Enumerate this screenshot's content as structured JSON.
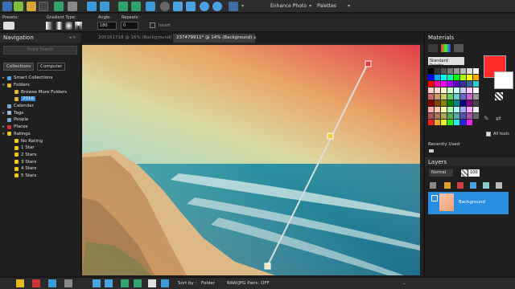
{
  "toolbar": {
    "enhance_photo": "Enhance Photo",
    "palettes": "Palettes"
  },
  "options": {
    "presets": "Presets:",
    "gradient_type": "Gradient Type:",
    "angle_label": "Angle:",
    "angle_value": "180",
    "repeats_label": "Repeats:",
    "repeats_value": "0",
    "invert": "Invert"
  },
  "navigation": {
    "title": "Navigation",
    "quick_search": "Quick Search",
    "tabs": [
      "Collections",
      "Computer"
    ],
    "tree": [
      {
        "label": "Smart Collections",
        "indent": 1,
        "arrow": "▸",
        "color": "#4aa3e0"
      },
      {
        "label": "Folders",
        "indent": 1,
        "arrow": "▾",
        "color": "#e5b33a"
      },
      {
        "label": "Browse More Folders",
        "indent": 2,
        "arrow": "",
        "color": "#e5b33a"
      },
      {
        "label": "2016",
        "indent": 2,
        "arrow": "",
        "color": "#e5b33a",
        "selected": true
      },
      {
        "label": "Calendar",
        "indent": 1,
        "arrow": "",
        "color": "#6fa7d8"
      },
      {
        "label": "Tags",
        "indent": 1,
        "arrow": "▸",
        "color": "#9ec0e0"
      },
      {
        "label": "People",
        "indent": 1,
        "arrow": "",
        "color": "#6fa7d8"
      },
      {
        "label": "Places",
        "indent": 1,
        "arrow": "▸",
        "color": "#d0342c"
      },
      {
        "label": "Ratings",
        "indent": 1,
        "arrow": "▾",
        "color": "#f0c419"
      },
      {
        "label": "No Rating",
        "indent": 2,
        "arrow": "",
        "color": "#f0c419"
      },
      {
        "label": "1 Star",
        "indent": 2,
        "arrow": "",
        "color": "#f0c419"
      },
      {
        "label": "2 Stars",
        "indent": 2,
        "arrow": "",
        "color": "#f0c419"
      },
      {
        "label": "3 Stars",
        "indent": 2,
        "arrow": "",
        "color": "#f0c419"
      },
      {
        "label": "4 Stars",
        "indent": 2,
        "arrow": "",
        "color": "#f0c419"
      },
      {
        "label": "5 Stars",
        "indent": 2,
        "arrow": "",
        "color": "#f0c419"
      }
    ]
  },
  "documents": {
    "tab1": "205161718 @ 16% (Background)",
    "tab2": "237479911* @ 14% (Background)"
  },
  "materials": {
    "title": "Materials",
    "palette": "Standard Palette",
    "recently_used": "Recently Used",
    "all_tools": "All tools",
    "foreground": "#ff2a2a",
    "background": "#ffffff"
  },
  "layers": {
    "title": "Layers",
    "blend": "Normal",
    "opacity": "100",
    "layer_name": "Background"
  },
  "status": {
    "sort_by": "Sort by :",
    "folder": "Folder",
    "raw_pairs": "RAW/JPG Pairs: OFF"
  }
}
